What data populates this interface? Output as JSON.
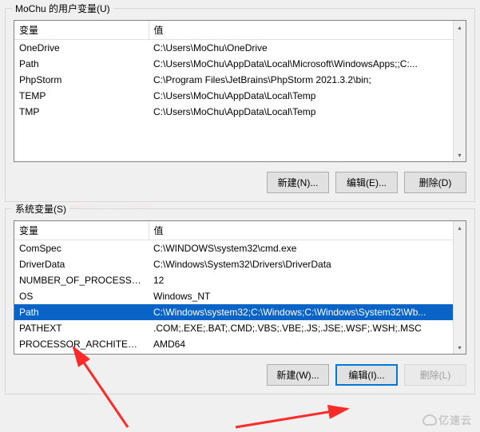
{
  "user_section": {
    "label": "MoChu 的用户变量(U)",
    "header_name": "变量",
    "header_value": "值",
    "rows": [
      {
        "name": "OneDrive",
        "value": "C:\\Users\\MoChu\\OneDrive"
      },
      {
        "name": "Path",
        "value": "C:\\Users\\MoChu\\AppData\\Local\\Microsoft\\WindowsApps;;C:..."
      },
      {
        "name": "PhpStorm",
        "value": "C:\\Program Files\\JetBrains\\PhpStorm 2021.3.2\\bin;"
      },
      {
        "name": "TEMP",
        "value": "C:\\Users\\MoChu\\AppData\\Local\\Temp"
      },
      {
        "name": "TMP",
        "value": "C:\\Users\\MoChu\\AppData\\Local\\Temp"
      }
    ],
    "buttons": {
      "new": "新建(N)...",
      "edit": "编辑(E)...",
      "delete": "删除(D)"
    }
  },
  "system_section": {
    "label": "系统变量(S)",
    "header_name": "变量",
    "header_value": "值",
    "rows": [
      {
        "name": "ComSpec",
        "value": "C:\\WINDOWS\\system32\\cmd.exe",
        "selected": false
      },
      {
        "name": "DriverData",
        "value": "C:\\Windows\\System32\\Drivers\\DriverData",
        "selected": false
      },
      {
        "name": "NUMBER_OF_PROCESSORS",
        "value": "12",
        "selected": false
      },
      {
        "name": "OS",
        "value": "Windows_NT",
        "selected": false
      },
      {
        "name": "Path",
        "value": "C:\\Windows\\system32;C:\\Windows;C:\\Windows\\System32\\Wb...",
        "selected": true
      },
      {
        "name": "PATHEXT",
        "value": ".COM;.EXE;.BAT;.CMD;.VBS;.VBE;.JS;.JSE;.WSF;.WSH;.MSC",
        "selected": false
      },
      {
        "name": "PROCESSOR_ARCHITECT...",
        "value": "AMD64",
        "selected": false
      }
    ],
    "buttons": {
      "new": "新建(W)...",
      "edit": "编辑(I)...",
      "delete": "删除(L)"
    }
  },
  "watermark": "亿速云",
  "annotation_color": "#ff2a2a"
}
